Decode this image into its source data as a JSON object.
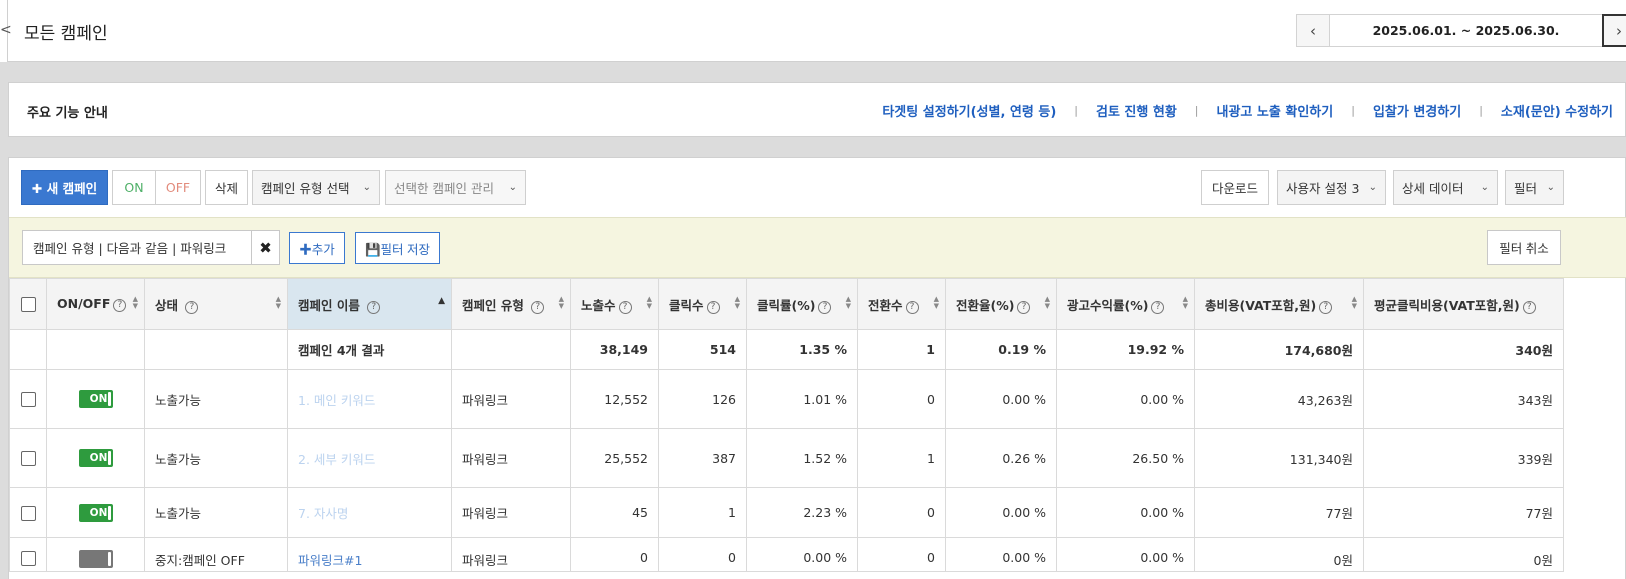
{
  "header": {
    "edge_mark": "<",
    "title": "모든 캠페인",
    "date_range": "2025.06.01. ~ 2025.06.30.",
    "prev_glyph": "‹",
    "next_glyph": "›"
  },
  "guide": {
    "title": "주요 기능 안내",
    "links": [
      "타겟팅 설정하기(성별, 연령 등)",
      "검토 진행 현황",
      "내광고 노출 확인하기",
      "입찰가 변경하기",
      "소재(문안) 수정하기"
    ],
    "separator": "|"
  },
  "toolbar": {
    "new_campaign": "✚ 새 캠페인",
    "on": "ON",
    "off": "OFF",
    "delete": "삭제",
    "type_select": "캠페인 유형 선택",
    "manage_select": "선택한 캠페인 관리",
    "download": "다운로드",
    "user_setting": "사용자 설정 3",
    "detail_data": "상세 데이터",
    "filter": "필터",
    "chevron": "⌄"
  },
  "filterbar": {
    "chip": "캠페인 유형 | 다음과 같음 | 파워링크",
    "chip_remove": "✖",
    "add": "✚추가",
    "save": "💾필터 저장",
    "cancel": "필터 취소"
  },
  "table": {
    "columns": [
      {
        "label": "ON/OFF",
        "help": "?"
      },
      {
        "label": "상태",
        "help": "?"
      },
      {
        "label": "캠페인 이름",
        "help": "?"
      },
      {
        "label": "캠페인 유형",
        "help": "?"
      },
      {
        "label": "노출수",
        "help": "?"
      },
      {
        "label": "클릭수",
        "help": "?"
      },
      {
        "label": "클릭률(%)",
        "help": "?"
      },
      {
        "label": "전환수",
        "help": "?"
      },
      {
        "label": "전환율(%)",
        "help": "?"
      },
      {
        "label": "광고수익률(%)",
        "help": "?"
      },
      {
        "label": "총비용(VAT포함,원)",
        "help": "?"
      },
      {
        "label": "평균클릭비용(VAT포함,원)",
        "help": "?"
      }
    ],
    "summary": {
      "name": "캠페인 4개 결과",
      "impressions": "38,149",
      "clicks": "514",
      "ctr": "1.35 %",
      "conversions": "1",
      "cvr": "0.19 %",
      "roas": "19.92 %",
      "cost": "174,680원",
      "cpc": "340원"
    },
    "rows": [
      {
        "toggle": "ON",
        "status": "노출가능",
        "name": "1. 메인 키워드",
        "type": "파워링크",
        "impressions": "12,552",
        "clicks": "126",
        "ctr": "1.01 %",
        "conversions": "0",
        "cvr": "0.00 %",
        "roas": "0.00 %",
        "cost": "43,263원",
        "cpc": "343원"
      },
      {
        "toggle": "ON",
        "status": "노출가능",
        "name": "2. 세부 키워드",
        "type": "파워링크",
        "impressions": "25,552",
        "clicks": "387",
        "ctr": "1.52 %",
        "conversions": "1",
        "cvr": "0.26 %",
        "roas": "26.50 %",
        "cost": "131,340원",
        "cpc": "339원"
      },
      {
        "toggle": "ON",
        "status": "노출가능",
        "name": "7. 자사명",
        "type": "파워링크",
        "impressions": "45",
        "clicks": "1",
        "ctr": "2.23 %",
        "conversions": "0",
        "cvr": "0.00 %",
        "roas": "0.00 %",
        "cost": "77원",
        "cpc": "77원"
      },
      {
        "toggle": "",
        "status": "중지:캠페인 OFF",
        "name": "파워링크#1",
        "type": "파워링크",
        "impressions": "0",
        "clicks": "0",
        "ctr": "0.00 %",
        "conversions": "0",
        "cvr": "0.00 %",
        "roas": "0.00 %",
        "cost": "0원",
        "cpc": "0원"
      }
    ]
  }
}
